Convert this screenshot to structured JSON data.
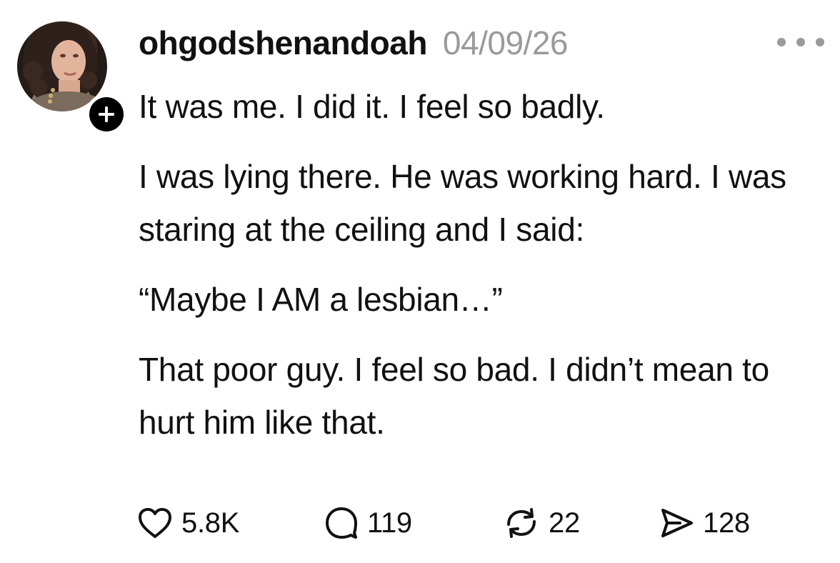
{
  "post": {
    "author": {
      "username": "ohgodshenandoah",
      "avatar_icon": "profile-photo",
      "follow_icon": "plus-icon"
    },
    "timestamp": "04/09/26",
    "more_icon": "more-dots-icon",
    "paragraphs": [
      "It was me. I did it. I feel so badly.",
      "I was lying there. He was working hard. I was staring at the ceiling and I said:",
      "“Maybe I AM a lesbian…”",
      "That poor guy. I feel so bad. I didn’t mean to hurt him like that."
    ],
    "actions": {
      "likes": {
        "icon": "heart-icon",
        "count": "5.8K"
      },
      "replies": {
        "icon": "comment-icon",
        "count": "119"
      },
      "reposts": {
        "icon": "repost-icon",
        "count": "22"
      },
      "shares": {
        "icon": "send-icon",
        "count": "128"
      }
    }
  },
  "colors": {
    "text": "#111111",
    "muted": "#9a9a9a",
    "background": "#ffffff",
    "badge": "#000000"
  }
}
